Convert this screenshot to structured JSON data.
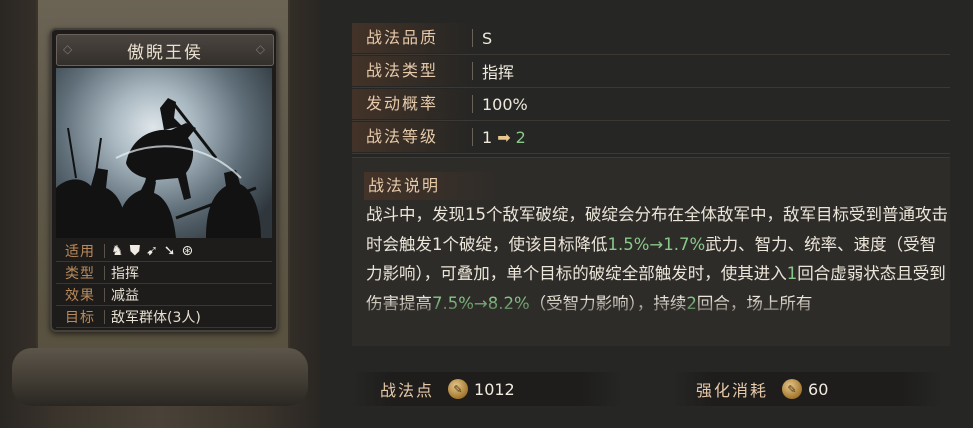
{
  "card": {
    "title": "傲睨王侯",
    "attributes": [
      {
        "label": "适用",
        "icons": [
          "cavalry-icon",
          "shield-icon",
          "bow-icon",
          "spear-icon",
          "chariot-icon"
        ]
      },
      {
        "label": "类型",
        "value": "指挥"
      },
      {
        "label": "效果",
        "value": "减益"
      },
      {
        "label": "目标",
        "value": "敌军群体(3人)"
      }
    ]
  },
  "info": {
    "quality_label": "战法品质",
    "quality_value": "S",
    "type_label": "战法类型",
    "type_value": "指挥",
    "rate_label": "发动概率",
    "rate_value": "100%",
    "level_label": "战法等级",
    "level_from": "1",
    "level_to": "2"
  },
  "description": {
    "title": "战法说明",
    "text_1": "战斗中，发现15个敌军破绽，破绽会分布在全体敌军中，敌军目标受到普通攻击时会触发1个破绽，使该目标降低",
    "highlight_1": "1.5%→1.7%",
    "text_2": "武力、智力、统率、速度（受智力影响），可叠加，单个目标的破绽全部触发时，使其进入",
    "highlight_2": "1",
    "text_3": "回合虚弱状态且受到伤害提高",
    "highlight_3": "7.5%→8.2%",
    "text_4": "（受智力影响），持续",
    "highlight_4": "2",
    "text_5": "回合，场上所有"
  },
  "bottom": {
    "points_label": "战法点",
    "points_value": "1012",
    "cost_label": "强化消耗",
    "cost_value": "60"
  },
  "colors": {
    "label": "#e6c9a9",
    "highlight": "#88c98a",
    "attr_label": "#b88a5c"
  }
}
